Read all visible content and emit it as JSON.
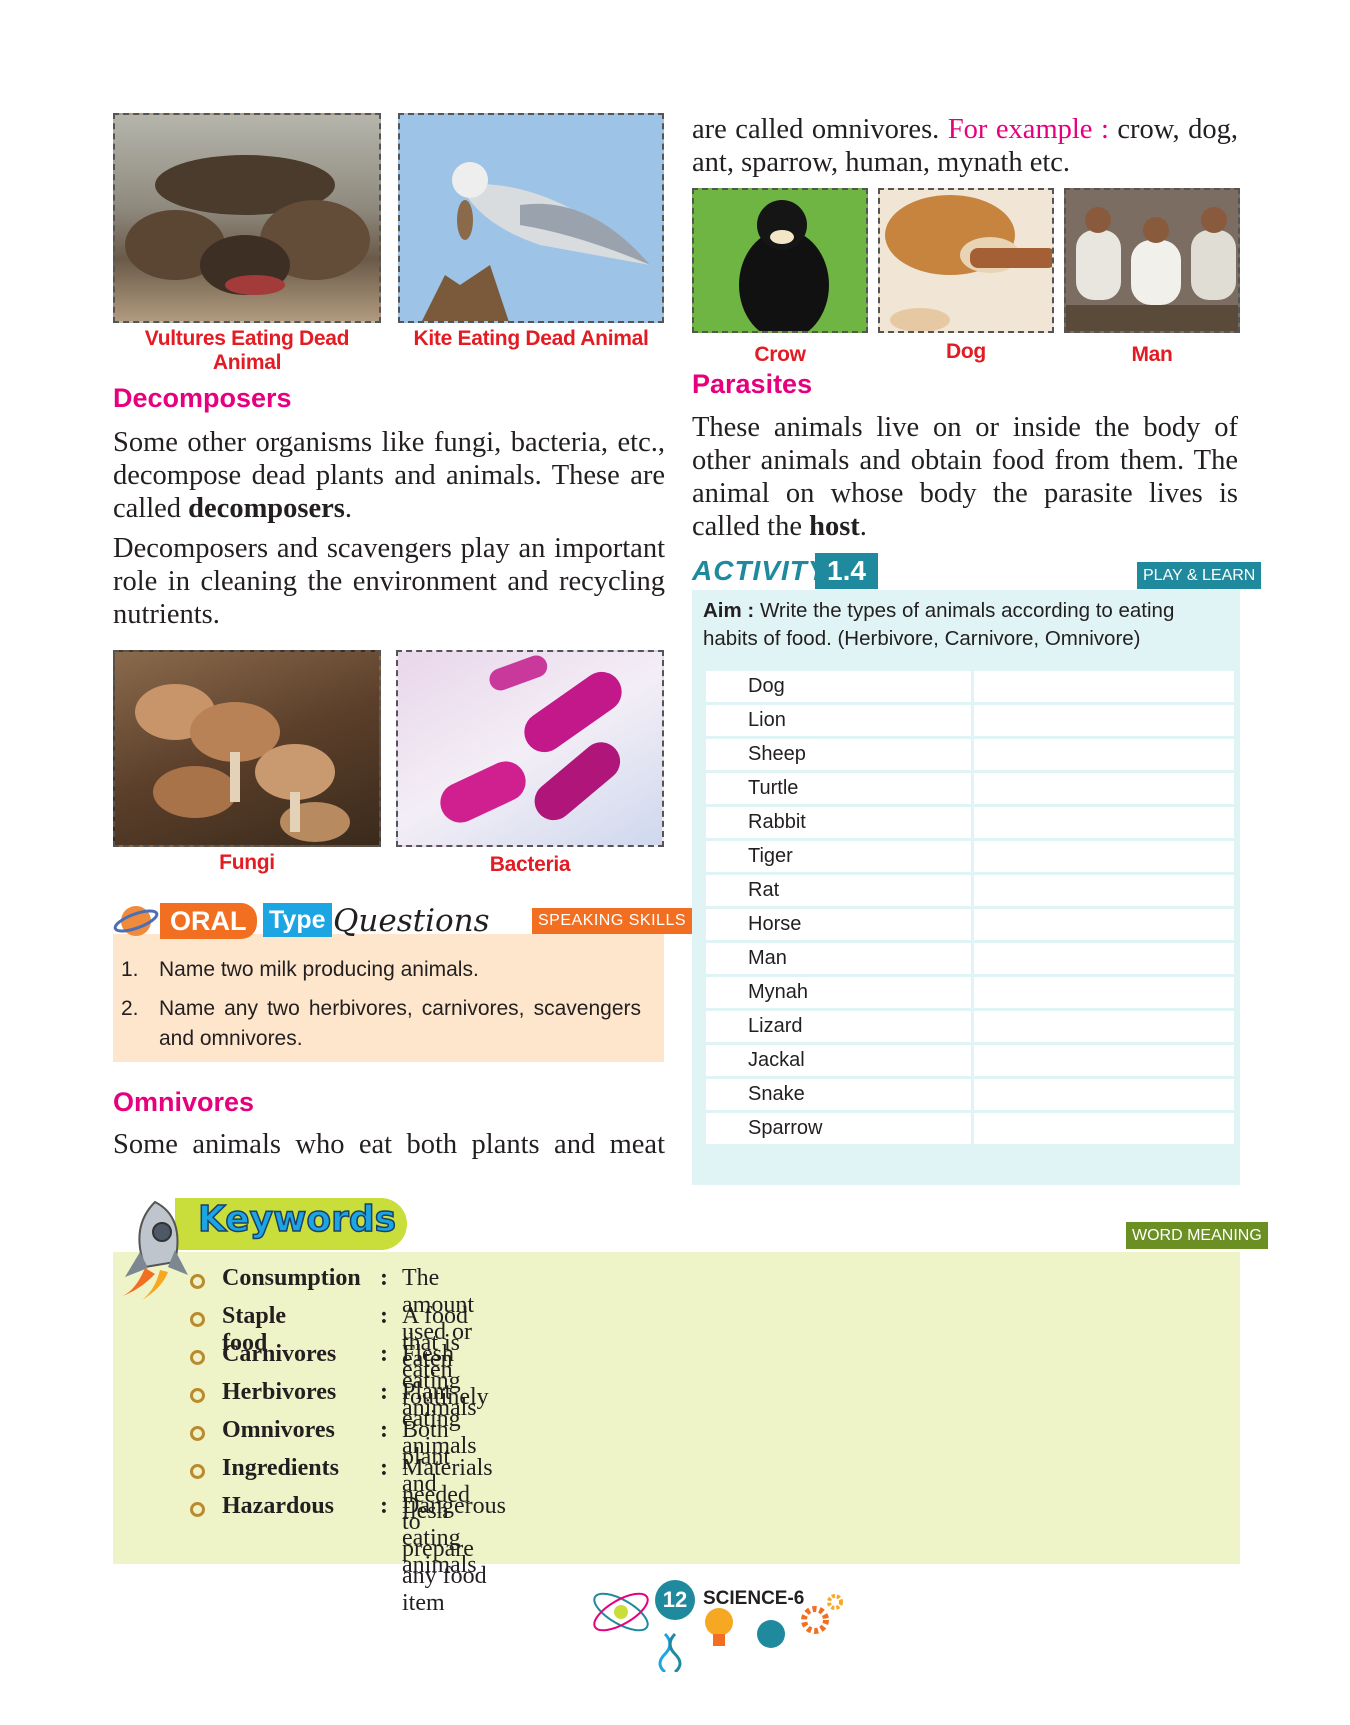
{
  "top_photos": {
    "vultures_caption": "Vultures Eating Dead Animal",
    "kite_caption": "Kite Eating Dead Animal"
  },
  "decomposers": {
    "heading": "Decomposers",
    "para1_text": "Some other organisms like fungi, bacteria, etc., decompose dead plants and animals. These are called ",
    "para1_bold": "decomposers",
    "para1_end": ".",
    "para2": "Decomposers and scavengers play an important role in cleaning the environment and recycling nutrients.",
    "fungi_caption": "Fungi",
    "bacteria_caption": "Bacteria"
  },
  "oral": {
    "oral_label": "ORAL",
    "type_label": "Type",
    "questions_label": "Questions",
    "skill_badge": "SPEAKING SKILLS",
    "items": [
      {
        "num": "1.",
        "text": "Name two milk producing animals."
      },
      {
        "num": "2.",
        "text": "Name any two herbivores, carnivores, scavengers and omnivores."
      }
    ]
  },
  "omnivores": {
    "heading": "Omnivores",
    "para_start": "Some animals who eat both plants and meat",
    "para_cont": "are called omnivores.",
    "example_label": "For example :",
    "example_rest": "crow, dog, ant, sparrow, human, mynath etc.",
    "crow_caption": "Crow",
    "dog_caption": "Dog",
    "man_caption": "Man"
  },
  "parasites": {
    "heading": "Parasites",
    "para_text": "These animals live on or inside the body of other animals and obtain food from them. The animal on whose body the parasite lives is called the ",
    "para_bold": "host",
    "para_end": "."
  },
  "activity": {
    "label": "ACTIVITY",
    "number": "1.4",
    "badge": "PLAY & LEARN",
    "aim_label": "Aim :",
    "aim_text": "Write the types of animals according to eating habits of food. (Herbivore, Carnivore, Omnivore)",
    "animals": [
      "Dog",
      "Lion",
      "Sheep",
      "Turtle",
      "Rabbit",
      "Tiger",
      "Rat",
      "Horse",
      "Man",
      "Mynah",
      "Lizard",
      "Jackal",
      "Snake",
      "Sparrow"
    ]
  },
  "keywords": {
    "title": "Keywords",
    "badge": "WORD MEANING",
    "items": [
      {
        "term": "Consumption",
        "def": "The amount used or eaten"
      },
      {
        "term": "Staple food",
        "def": "A food that is eaten routinely"
      },
      {
        "term": "Carnivores",
        "def": "Flesh eating animals"
      },
      {
        "term": "Herbivores",
        "def": "Plant eating animals"
      },
      {
        "term": "Omnivores",
        "def": "Both plant and flesh eating animals"
      },
      {
        "term": "Ingredients",
        "def": "Materials needed to prepare any food item"
      },
      {
        "term": "Hazardous",
        "def": "Dangerous"
      }
    ]
  },
  "footer": {
    "page_number": "12",
    "book": "SCIENCE-6"
  },
  "colors": {
    "heading_pink": "#e6007e",
    "caption_red": "#e31b23",
    "activity_teal": "#1f8a9e",
    "activity_bg": "#e1f4f5",
    "oral_bg": "#fde6cc",
    "keywords_bg": "#eef4c8"
  }
}
